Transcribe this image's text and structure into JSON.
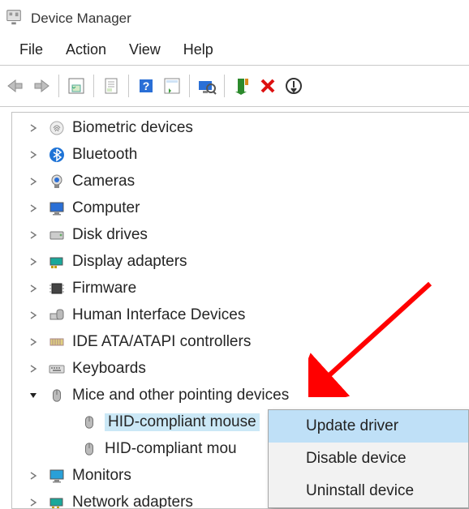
{
  "titlebar": {
    "title": "Device Manager"
  },
  "menubar": {
    "items": [
      "File",
      "Action",
      "View",
      "Help"
    ]
  },
  "toolbar": {
    "buttons": [
      "back",
      "forward",
      "show-hidden",
      "properties",
      "help",
      "action-list",
      "scan",
      "device-add",
      "uninstall-x",
      "down-arrow"
    ]
  },
  "tree": {
    "categories": [
      {
        "label": "Biometric devices",
        "expanded": false,
        "icon": "fingerprint"
      },
      {
        "label": "Bluetooth",
        "expanded": false,
        "icon": "bluetooth"
      },
      {
        "label": "Cameras",
        "expanded": false,
        "icon": "camera"
      },
      {
        "label": "Computer",
        "expanded": false,
        "icon": "computer"
      },
      {
        "label": "Disk drives",
        "expanded": false,
        "icon": "disk"
      },
      {
        "label": "Display adapters",
        "expanded": false,
        "icon": "display"
      },
      {
        "label": "Firmware",
        "expanded": false,
        "icon": "firmware"
      },
      {
        "label": "Human Interface Devices",
        "expanded": false,
        "icon": "hid"
      },
      {
        "label": "IDE ATA/ATAPI controllers",
        "expanded": false,
        "icon": "ide"
      },
      {
        "label": "Keyboards",
        "expanded": false,
        "icon": "keyboard"
      },
      {
        "label": "Mice and other pointing devices",
        "expanded": true,
        "icon": "mouse",
        "children": [
          {
            "label": "HID-compliant mouse",
            "selected": true
          },
          {
            "label": "HID-compliant mou",
            "selected": false
          }
        ]
      },
      {
        "label": "Monitors",
        "expanded": false,
        "icon": "monitor"
      },
      {
        "label": "Network adapters",
        "expanded": false,
        "icon": "network"
      }
    ]
  },
  "context_menu": {
    "items": [
      "Update driver",
      "Disable device",
      "Uninstall device"
    ],
    "selected_index": 0
  }
}
